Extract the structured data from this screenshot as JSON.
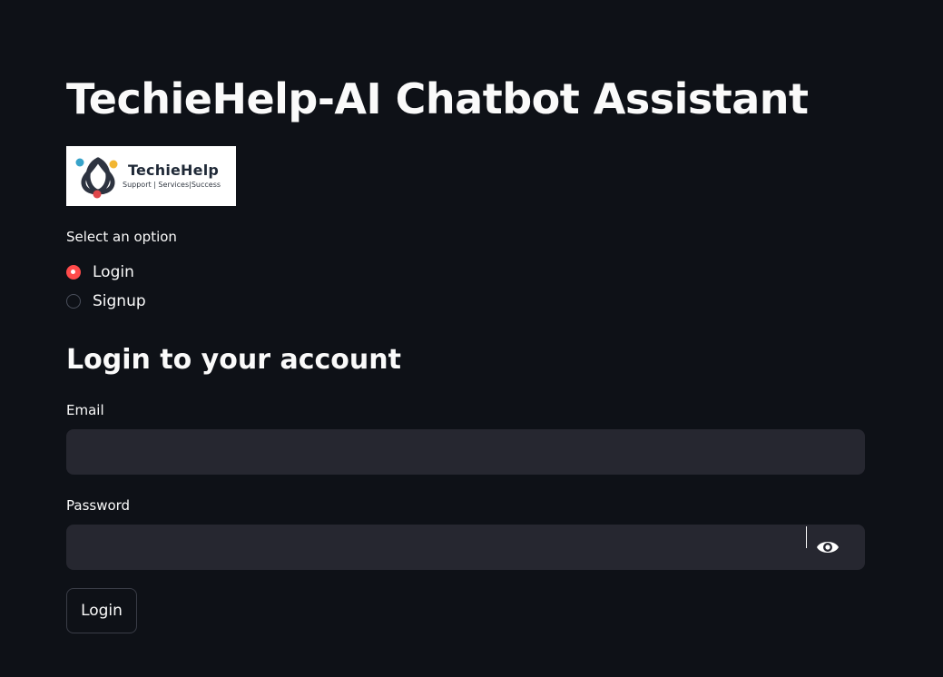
{
  "page": {
    "title": "TechieHelp-AI Chatbot Assistant"
  },
  "logo": {
    "name": "TechieHelp",
    "tagline": "Support | Services|Success"
  },
  "auth_mode": {
    "label": "Select an option",
    "options": [
      {
        "label": "Login",
        "selected": true
      },
      {
        "label": "Signup",
        "selected": false
      }
    ]
  },
  "login_form": {
    "heading": "Login to your account",
    "email": {
      "label": "Email",
      "value": "",
      "placeholder": ""
    },
    "password": {
      "label": "Password",
      "value": "",
      "placeholder": ""
    },
    "submit_label": "Login"
  },
  "colors": {
    "background": "#0e1117",
    "input_background": "#262730",
    "accent": "#ff4b4b",
    "text": "#fafafa"
  },
  "icons": {
    "password_toggle": "eye-icon",
    "logo_mark": "triquetra-logo-icon"
  }
}
